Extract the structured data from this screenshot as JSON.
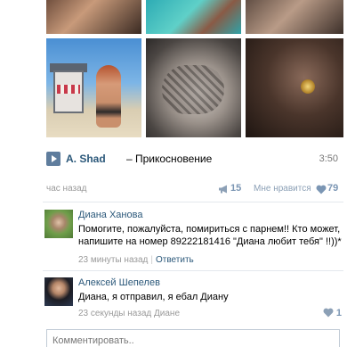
{
  "track": {
    "artist": "A. Shad",
    "separator": "–",
    "title": "Прикосновение",
    "duration": "3:50"
  },
  "post": {
    "time": "час назад",
    "shares": "15",
    "like_label": "Мне нравится",
    "likes": "79"
  },
  "comments": [
    {
      "author": "Диана Ханова",
      "text": "Помогите, пожалуйста, помириться с парнем!! Кто может, напишите на номер 89222181416 \"Диана любит тебя\" !!))*",
      "time": "23 минуты назад",
      "reply": "Ответить"
    },
    {
      "author": "Алексей Шепелев",
      "text": "Диана, я отправил, я ебал Диану",
      "time": "23 секунды назад Диане",
      "likes": "1"
    }
  ],
  "comment_box": {
    "placeholder": "Комментировать.."
  },
  "colors": {
    "link": "#2b587a",
    "muted": "#999999",
    "counter": "#7b96b4",
    "play_button": "#5f7d9d"
  },
  "icons": {
    "play": "play-icon",
    "share": "megaphone-icon",
    "like": "heart-icon"
  }
}
